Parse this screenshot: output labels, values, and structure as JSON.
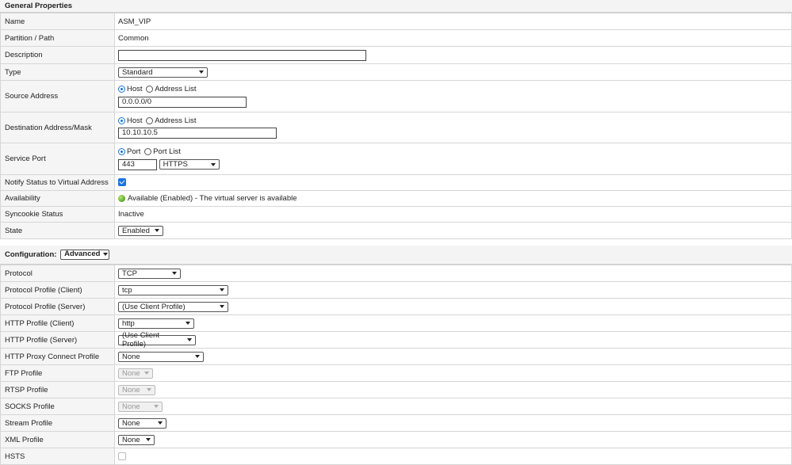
{
  "general": {
    "header": "General Properties",
    "name": {
      "label": "Name",
      "value": "ASM_VIP"
    },
    "partition": {
      "label": "Partition / Path",
      "value": "Common"
    },
    "description": {
      "label": "Description",
      "value": ""
    },
    "type": {
      "label": "Type",
      "value": "Standard"
    },
    "source": {
      "label": "Source Address",
      "opt_host": "Host",
      "opt_list": "Address List",
      "value": "0.0.0.0/0"
    },
    "destination": {
      "label": "Destination Address/Mask",
      "opt_host": "Host",
      "opt_list": "Address List",
      "value": "10.10.10.5"
    },
    "service_port": {
      "label": "Service Port",
      "opt_port": "Port",
      "opt_list": "Port List",
      "port": "443",
      "protocol": "HTTPS"
    },
    "notify": {
      "label": "Notify Status to Virtual Address",
      "checked": true
    },
    "availability": {
      "label": "Availability",
      "value": "Available (Enabled) - The virtual server is available"
    },
    "syncookie": {
      "label": "Syncookie Status",
      "value": "Inactive"
    },
    "state": {
      "label": "State",
      "value": "Enabled"
    }
  },
  "config": {
    "header": "Configuration:",
    "mode": "Advanced",
    "rows": {
      "protocol": {
        "label": "Protocol",
        "value": "TCP"
      },
      "profile_client": {
        "label": "Protocol Profile (Client)",
        "value": "tcp"
      },
      "profile_server": {
        "label": "Protocol Profile (Server)",
        "value": "(Use Client Profile)"
      },
      "http_client": {
        "label": "HTTP Profile (Client)",
        "value": "http"
      },
      "http_server": {
        "label": "HTTP Profile (Server)",
        "value": "(Use Client Profile)"
      },
      "http_proxy": {
        "label": "HTTP Proxy Connect Profile",
        "value": "None"
      },
      "ftp": {
        "label": "FTP Profile",
        "value": "None"
      },
      "rtsp": {
        "label": "RTSP Profile",
        "value": "None"
      },
      "socks": {
        "label": "SOCKS Profile",
        "value": "None"
      },
      "stream": {
        "label": "Stream Profile",
        "value": "None"
      },
      "xml": {
        "label": "XML Profile",
        "value": "None"
      },
      "partial": {
        "label": "HSTS"
      }
    }
  },
  "colors": {
    "accent": "#1a73e8",
    "available": "#5aa71e",
    "label_bg": "#f5f5f5"
  }
}
